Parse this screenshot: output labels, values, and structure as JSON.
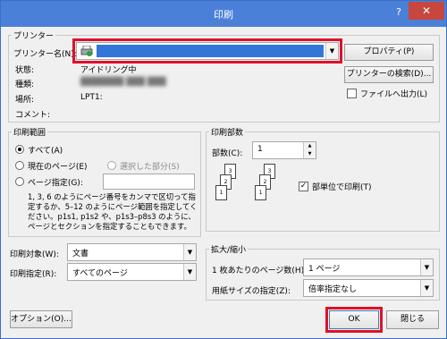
{
  "window": {
    "title": "印刷",
    "help": "?",
    "close": "✕"
  },
  "printer": {
    "group": "プリンター",
    "name_label": "プリンター名(N):",
    "name_value": "",
    "properties": "プロパティ(P)",
    "search": "プリンターの検索(D)...",
    "status_label": "状態:",
    "status_value": "アイドリング中",
    "type_label": "種類:",
    "type_value": "███████ ███ ███",
    "location_label": "場所:",
    "location_value": "LPT1:",
    "comment_label": "コメント:",
    "file_output": "ファイルへ出力(L)"
  },
  "range": {
    "group": "印刷範囲",
    "all": "すべて(A)",
    "current": "現在のページ(E)",
    "selection": "選択した部分(S)",
    "pages": "ページ指定(G):",
    "pages_value": "",
    "help_lines": [
      "1, 3, 6 のようにページ番号をカンマで区切って指",
      "定するか、5–12 のようにページ範囲を指定してく",
      "ださい。p1s1, p1s2 や、p1s3–p8s3 のように、",
      "ページとセクションを指定することもできます。"
    ]
  },
  "copies": {
    "group": "印刷部数",
    "label": "部数(C):",
    "value": "1",
    "collate": "部単位で印刷(T)",
    "sheets": [
      "3",
      "2",
      "1"
    ]
  },
  "print_what": {
    "label": "印刷対象(W):",
    "value": "文書"
  },
  "print_scope": {
    "label": "印刷指定(R):",
    "value": "すべてのページ"
  },
  "zoom": {
    "group": "拡大/縮小",
    "pps_label": "1 枚あたりのページ数(H):",
    "pps_value": "1 ページ",
    "scale_label": "用紙サイズの指定(Z):",
    "scale_value": "倍率指定なし"
  },
  "footer": {
    "options": "オプション(O)...",
    "ok": "OK",
    "close": "閉じる"
  }
}
